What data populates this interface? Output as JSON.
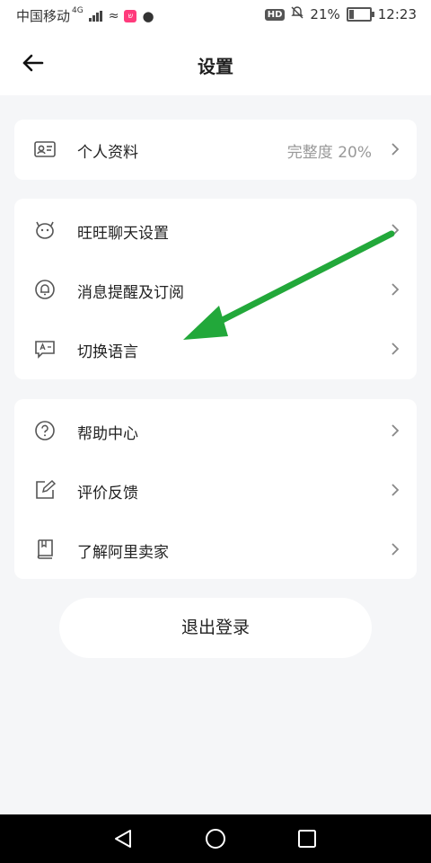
{
  "status_bar": {
    "carrier": "中国移动",
    "network": "4G",
    "badge": "ש",
    "battery_percent": "21%",
    "battery_level": 0.21,
    "time": "12:23",
    "hd_label": "HD"
  },
  "header": {
    "title": "设置"
  },
  "sections": {
    "profile": {
      "label": "个人资料",
      "value": "完整度 20%"
    },
    "chat": {
      "label": "旺旺聊天设置"
    },
    "notify": {
      "label": "消息提醒及订阅"
    },
    "language": {
      "label": "切换语言"
    },
    "help": {
      "label": "帮助中心"
    },
    "feedback": {
      "label": "评价反馈"
    },
    "about": {
      "label": "了解阿里卖家"
    }
  },
  "logout": {
    "label": "退出登录"
  },
  "colors": {
    "arrow": "#22a83a",
    "background": "#f5f6f8",
    "card": "#ffffff"
  }
}
